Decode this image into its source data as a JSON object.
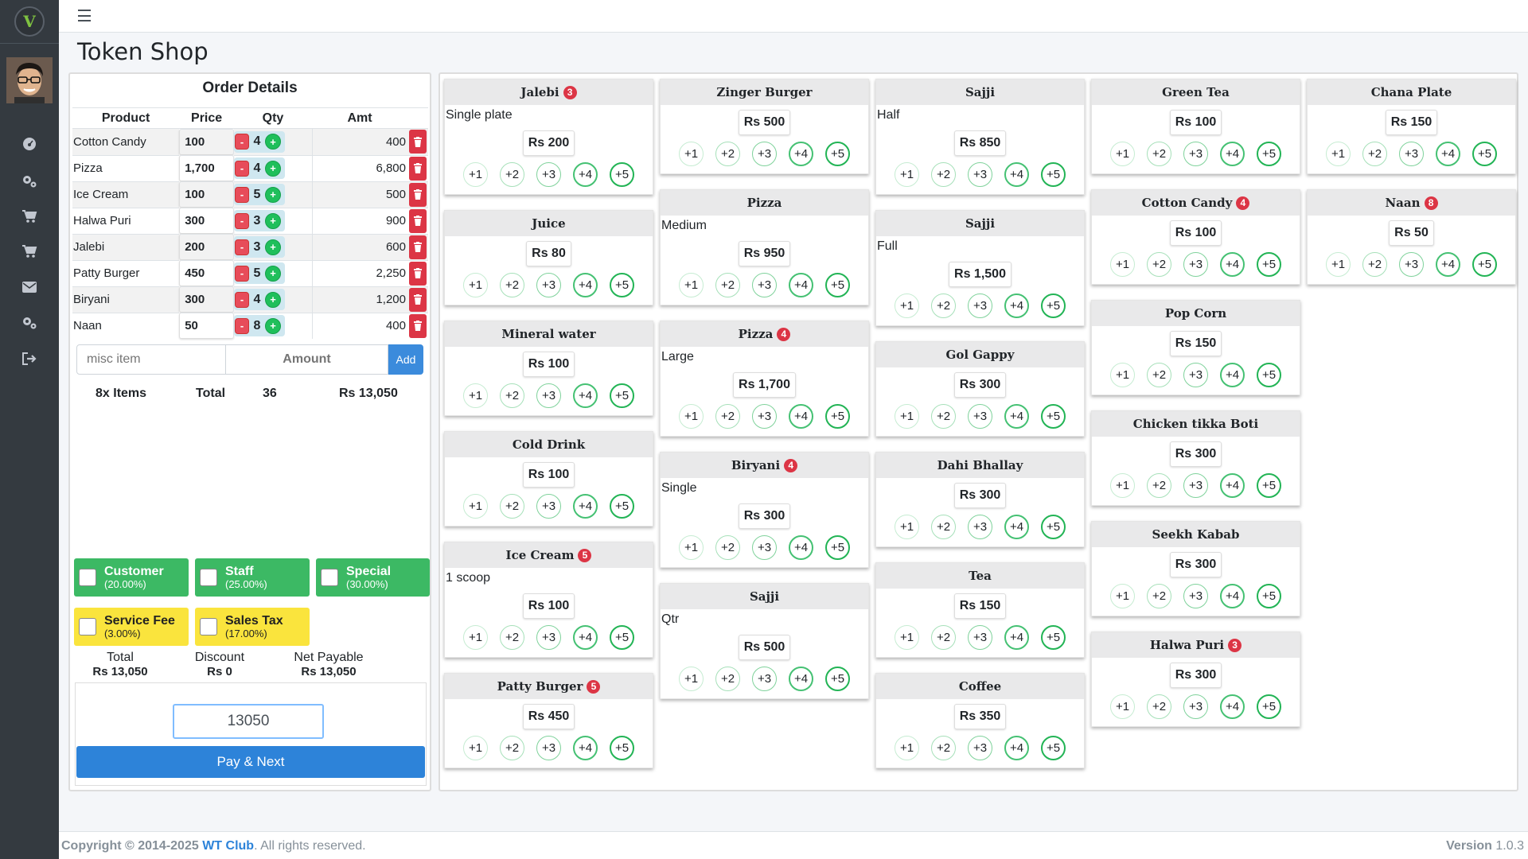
{
  "app": {
    "title": "Token Shop"
  },
  "sidebar": {
    "icons": [
      "dashboard-icon",
      "cogs-icon",
      "cart-icon",
      "cart-icon",
      "envelope-icon",
      "cogs-icon",
      "sign-out-icon"
    ]
  },
  "order": {
    "title": "Order Details",
    "headers": {
      "product": "Product",
      "price": "Price",
      "qty": "Qty",
      "amt": "Amt"
    },
    "items": [
      {
        "product": "Cotton Candy",
        "price": "100",
        "qty": "4",
        "amt": "400"
      },
      {
        "product": "Pizza",
        "price": "1,700",
        "qty": "4",
        "amt": "6,800"
      },
      {
        "product": "Ice Cream",
        "price": "100",
        "qty": "5",
        "amt": "500"
      },
      {
        "product": "Halwa Puri",
        "price": "300",
        "qty": "3",
        "amt": "900"
      },
      {
        "product": "Jalebi",
        "price": "200",
        "qty": "3",
        "amt": "600"
      },
      {
        "product": "Patty Burger",
        "price": "450",
        "qty": "5",
        "amt": "2,250"
      },
      {
        "product": "Biryani",
        "price": "300",
        "qty": "4",
        "amt": "1,200"
      },
      {
        "product": "Naan",
        "price": "50",
        "qty": "8",
        "amt": "400"
      }
    ],
    "minus_label": "-",
    "plus_label": "+",
    "misc_placeholder": "misc item",
    "amount_placeholder": "Amount",
    "add_label": "Add",
    "summary": {
      "items": "8x Items",
      "total_label": "Total",
      "qty_total": "36",
      "amount": "Rs 13,050"
    },
    "discounts": [
      {
        "label": "Customer",
        "pct": "(20.00%)"
      },
      {
        "label": "Staff",
        "pct": "(25.00%)"
      },
      {
        "label": "Special",
        "pct": "(30.00%)"
      }
    ],
    "fees": [
      {
        "label": "Service Fee",
        "pct": "(3.00%)"
      },
      {
        "label": "Sales Tax",
        "pct": "(17.00%)"
      }
    ],
    "totals": {
      "total_label": "Total",
      "total": "Rs 13,050",
      "discount_label": "Discount",
      "discount": "Rs 0",
      "net_label": "Net Payable",
      "net": "Rs 13,050"
    },
    "pay_value": "13050",
    "pay_label": "Pay & Next"
  },
  "add_labels": [
    "+1",
    "+2",
    "+3",
    "+4",
    "+5"
  ],
  "products": [
    {
      "name": "Jalebi",
      "badge": "3",
      "sub": "Single plate",
      "price": "Rs 200"
    },
    {
      "name": "Juice",
      "badge": "",
      "sub": "",
      "price": "Rs 80"
    },
    {
      "name": "Mineral water",
      "badge": "",
      "sub": "",
      "price": "Rs 100"
    },
    {
      "name": "Cold Drink",
      "badge": "",
      "sub": "",
      "price": "Rs 100"
    },
    {
      "name": "Ice Cream",
      "badge": "5",
      "sub": "1 scoop",
      "price": "Rs 100"
    },
    {
      "name": "Patty Burger",
      "badge": "5",
      "sub": "",
      "price": "Rs 450"
    },
    {
      "name": "Zinger Burger",
      "badge": "",
      "sub": "",
      "price": "Rs 500"
    },
    {
      "name": "Pizza",
      "badge": "",
      "sub": "Medium",
      "price": "Rs 950"
    },
    {
      "name": "Pizza",
      "badge": "4",
      "sub": "Large",
      "price": "Rs 1,700"
    },
    {
      "name": "Biryani",
      "badge": "4",
      "sub": "Single",
      "price": "Rs 300"
    },
    {
      "name": "Sajji",
      "badge": "",
      "sub": "Qtr",
      "price": "Rs 500"
    },
    {
      "name": "Sajji",
      "badge": "",
      "sub": "Half",
      "price": "Rs 850"
    },
    {
      "name": "Sajji",
      "badge": "",
      "sub": "Full",
      "price": "Rs 1,500"
    },
    {
      "name": "Gol Gappy",
      "badge": "",
      "sub": "",
      "price": "Rs 300"
    },
    {
      "name": "Dahi Bhallay",
      "badge": "",
      "sub": "",
      "price": "Rs 300"
    },
    {
      "name": "Tea",
      "badge": "",
      "sub": "",
      "price": "Rs 150"
    },
    {
      "name": "Coffee",
      "badge": "",
      "sub": "",
      "price": "Rs 350"
    },
    {
      "name": "Green Tea",
      "badge": "",
      "sub": "",
      "price": "Rs 100"
    },
    {
      "name": "Cotton Candy",
      "badge": "4",
      "sub": "",
      "price": "Rs 100"
    },
    {
      "name": "Pop Corn",
      "badge": "",
      "sub": "",
      "price": "Rs 150"
    },
    {
      "name": "Chicken tikka Boti",
      "badge": "",
      "sub": "",
      "price": "Rs 300"
    },
    {
      "name": "Seekh Kabab",
      "badge": "",
      "sub": "",
      "price": "Rs 300"
    },
    {
      "name": "Halwa Puri",
      "badge": "3",
      "sub": "",
      "price": "Rs 300"
    },
    {
      "name": "Chana Plate",
      "badge": "",
      "sub": "",
      "price": "Rs 150"
    },
    {
      "name": "Naan",
      "badge": "8",
      "sub": "",
      "price": "Rs 50"
    }
  ],
  "footer": {
    "copyright": "Copyright © 2014-2025",
    "club": "WT Club",
    "rights": ". All rights reserved.",
    "version_label": "Version",
    "version": "1.0.3"
  },
  "colors": {
    "sidebar": "#343a40",
    "primary": "#2d83d9",
    "danger": "#dc3545",
    "success": "#3cb964",
    "warning": "#fae43d"
  }
}
